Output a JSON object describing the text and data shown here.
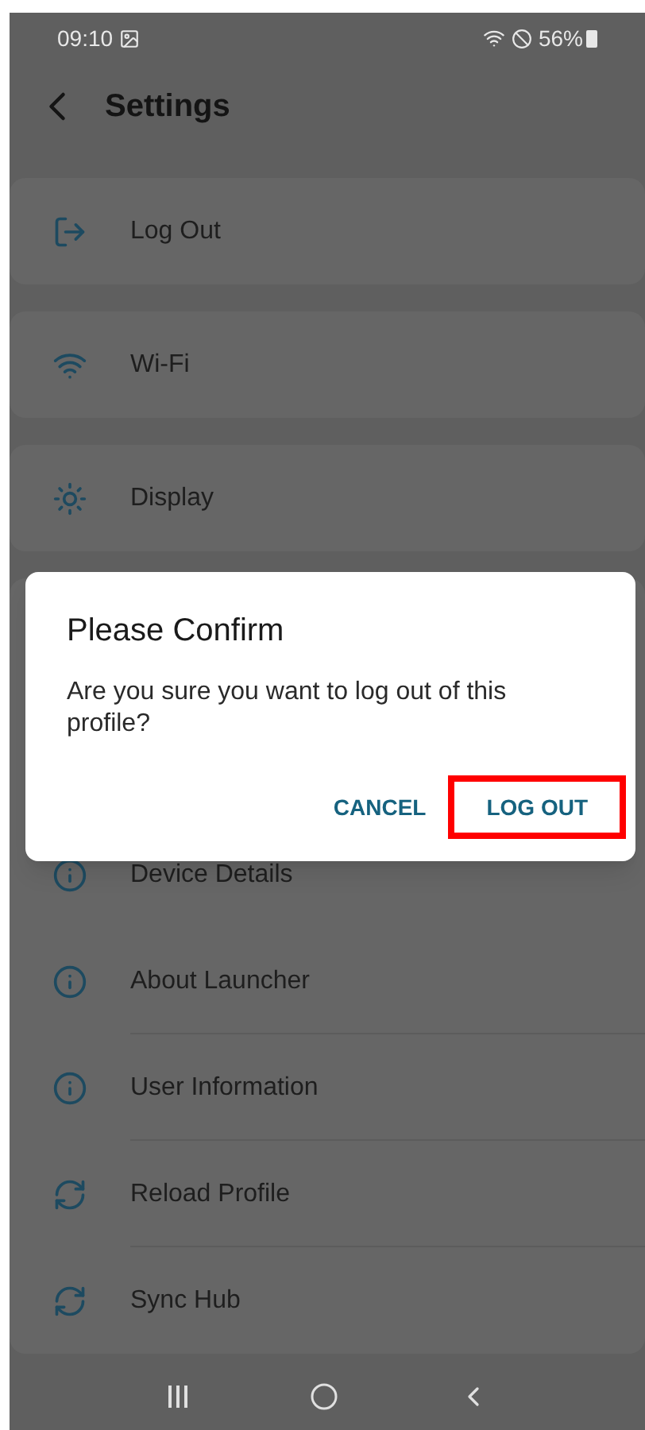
{
  "status_bar": {
    "time": "09:10",
    "battery": "56%"
  },
  "header": {
    "title": "Settings"
  },
  "cards": [
    {
      "items": [
        {
          "label": "Log Out",
          "kind": "logout"
        }
      ]
    },
    {
      "items": [
        {
          "label": "Wi-Fi",
          "kind": "wifi"
        }
      ]
    },
    {
      "items": [
        {
          "label": "Display",
          "kind": "display"
        }
      ]
    }
  ],
  "group": {
    "items": [
      {
        "label": "Device Details",
        "kind": "info"
      },
      {
        "label": "About Launcher",
        "kind": "info"
      },
      {
        "label": "User Information",
        "kind": "info"
      },
      {
        "label": "Reload Profile",
        "kind": "sync"
      },
      {
        "label": "Sync Hub",
        "kind": "sync"
      }
    ]
  },
  "dialog": {
    "title": "Please Confirm",
    "message": "Are you sure you want to log out of this profile?",
    "buttons": [
      {
        "label": "CANCEL",
        "highlighted": false
      },
      {
        "label": "LOG OUT",
        "highlighted": true
      }
    ]
  }
}
